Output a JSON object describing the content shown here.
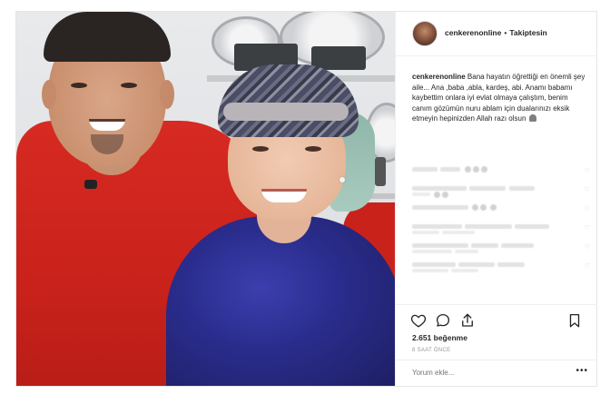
{
  "post": {
    "username": "cenkerenonline",
    "separator": "•",
    "follow_status": "Takiptesin",
    "caption_text": "Bana hayatın öğrettiği en önemli şey aile... Ana ,baba ,abla, kardeş, abi. Anamı babamı kaybettim onlara iyi evlat olmaya çalıştım, benim canım gözümün nuru ablam için dualarınızı eksik etmeyin hepinizden Allah razı olsun",
    "caption_emoji": "pray-icon",
    "likes": "2.651 beğenme",
    "time_ago": "8 SAAT ÖNCE",
    "comment_placeholder": "Yorum ekle...",
    "more_label": "•••"
  },
  "icons": [
    "heart-icon",
    "comment-icon",
    "share-icon",
    "bookmark-icon",
    "more-options-icon"
  ],
  "colors": {
    "text": "#262626",
    "muted": "#999999",
    "border": "#efefef"
  }
}
